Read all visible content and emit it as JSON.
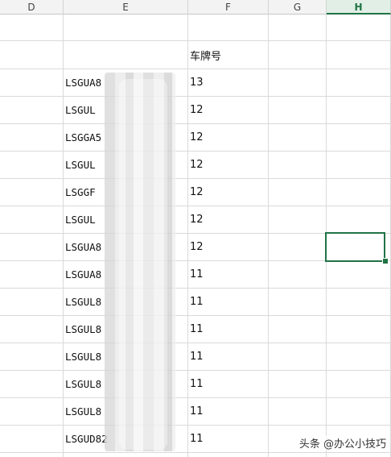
{
  "columns": [
    "D",
    "E",
    "F",
    "G",
    "H"
  ],
  "active_column": "H",
  "header_row": {
    "F": "车牌号"
  },
  "rows": [
    {
      "vin": "LSGUA8",
      "plate": "13"
    },
    {
      "vin": "LSGUL",
      "plate": "12"
    },
    {
      "vin": "LSGGA5",
      "plate": "12"
    },
    {
      "vin": "LSGUL",
      "plate": "12"
    },
    {
      "vin": "LSGGF",
      "plate": "12"
    },
    {
      "vin": "LSGUL",
      "plate": "12"
    },
    {
      "vin": "LSGUA8",
      "plate": "12"
    },
    {
      "vin": "LSGUA8",
      "plate": "11"
    },
    {
      "vin": "LSGUL8",
      "plate": "11"
    },
    {
      "vin": "LSGUL8",
      "plate": "11"
    },
    {
      "vin": "LSGUL8",
      "plate": "11"
    },
    {
      "vin": "LSGUL8",
      "plate": "11"
    },
    {
      "vin": "LSGUL8",
      "plate": "11"
    },
    {
      "vin": "LSGUD82",
      "plate": "11"
    }
  ],
  "watermark": "头条 @办公小技巧",
  "colors": {
    "accent": "#217346",
    "grid": "#dadada",
    "header_bg": "#f3f3f3"
  }
}
